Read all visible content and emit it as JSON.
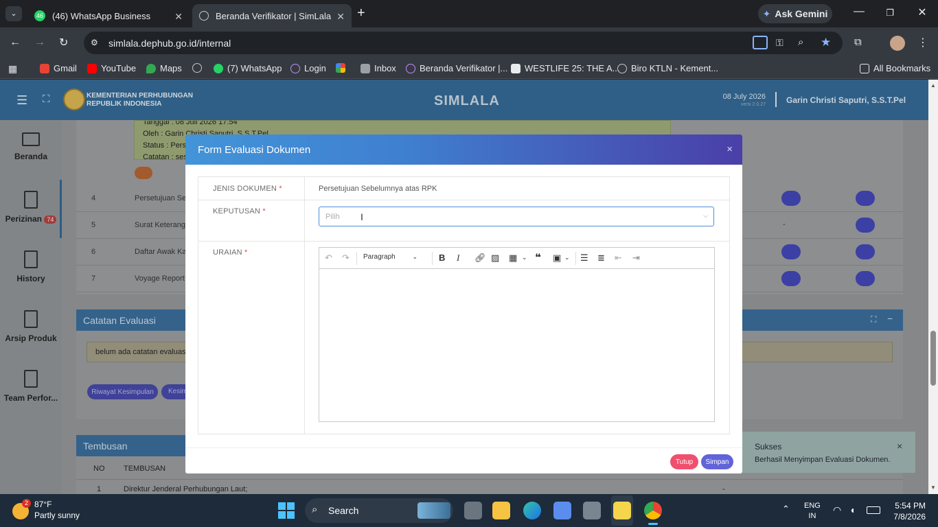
{
  "browser": {
    "tabs": [
      {
        "title": "(46) WhatsApp Business",
        "badge": "46"
      },
      {
        "title": "Beranda Verifikator | SimLala"
      }
    ],
    "ask_gemini": "Ask Gemini",
    "url": "simlala.dephub.go.id/internal",
    "bookmarks": [
      "Gmail",
      "YouTube",
      "Maps",
      "(7) WhatsApp",
      "Login",
      "Inbox",
      "Beranda Verifikator |...",
      "WESTLIFE 25: THE A...",
      "Biro KTLN - Kement..."
    ],
    "bookmarks_wa_badge": "46",
    "all_bookmarks": "All Bookmarks"
  },
  "app": {
    "org_line1": "KEMENTERIAN PERHUBUNGAN",
    "org_line2": "REPUBLIK INDONESIA",
    "title": "SIMLALA",
    "date": "08 July 2026",
    "version": "versi 2.0.27",
    "user": "Garin Christi Saputri, S.S.T.Pel"
  },
  "sidebar": [
    {
      "label": "Beranda",
      "icon": "monitor-icon"
    },
    {
      "label": "Perizinan",
      "icon": "document-icon",
      "badge": "74"
    },
    {
      "label": "History",
      "icon": "document-icon"
    },
    {
      "label": "Arsip Produk",
      "icon": "document-icon"
    },
    {
      "label": "Team Perfor...",
      "icon": "document-icon"
    }
  ],
  "background": {
    "note_lines": [
      "Tanggal : 08 Juli 2026 17:54",
      "Oleh : Garin Christi Saputri, S.S.T.Pel",
      "Status : Pers",
      "Catatan : ses"
    ],
    "rows": [
      {
        "no": "4",
        "name": "Persetujuan Seb"
      },
      {
        "no": "5",
        "name": "Surat Keterangan",
        "dash": "-"
      },
      {
        "no": "6",
        "name": "Daftar Awak Kap"
      },
      {
        "no": "7",
        "name": "Voyage Report ("
      }
    ],
    "catatan_title": "Catatan Evaluasi",
    "catatan_empty": "belum ada catatan evaluasi",
    "buttons": [
      "Riwayat Kesimpulan",
      "Kesim"
    ],
    "tembusan_title": "Tembusan",
    "tembusan_head": [
      "NO",
      "TEMBUSAN"
    ],
    "tembusan_row": {
      "no": "1",
      "text": "Direktur Jenderal Perhubungan Laut;",
      "dash": "-"
    }
  },
  "modal": {
    "title": "Form Evaluasi Dokumen",
    "close": "×",
    "fields": {
      "jenis_label": "JENIS DOKUMEN",
      "jenis_value": "Persetujuan Sebelumnya atas RPK",
      "keputusan_label": "KEPUTUSAN",
      "keputusan_placeholder": "Pilih",
      "uraian_label": "URAIAN",
      "required": "*"
    },
    "editor": {
      "format": "Paragraph"
    },
    "buttons": {
      "tutup": "Tutup",
      "simpan": "Simpan"
    }
  },
  "toast": {
    "title": "Sukses",
    "message": "Berhasil Menyimpan Evaluasi Dokumen.",
    "close": "×"
  },
  "taskbar": {
    "weather_temp": "87°F",
    "weather_desc": "Partly sunny",
    "weather_badge": "2",
    "search": "Search",
    "lang1": "ENG",
    "lang2": "IN",
    "time": "5:54 PM",
    "date": "7/8/2026"
  },
  "colors": {
    "accent": "#4a90e2",
    "danger": "#f0506e",
    "primary": "#6164d8"
  }
}
